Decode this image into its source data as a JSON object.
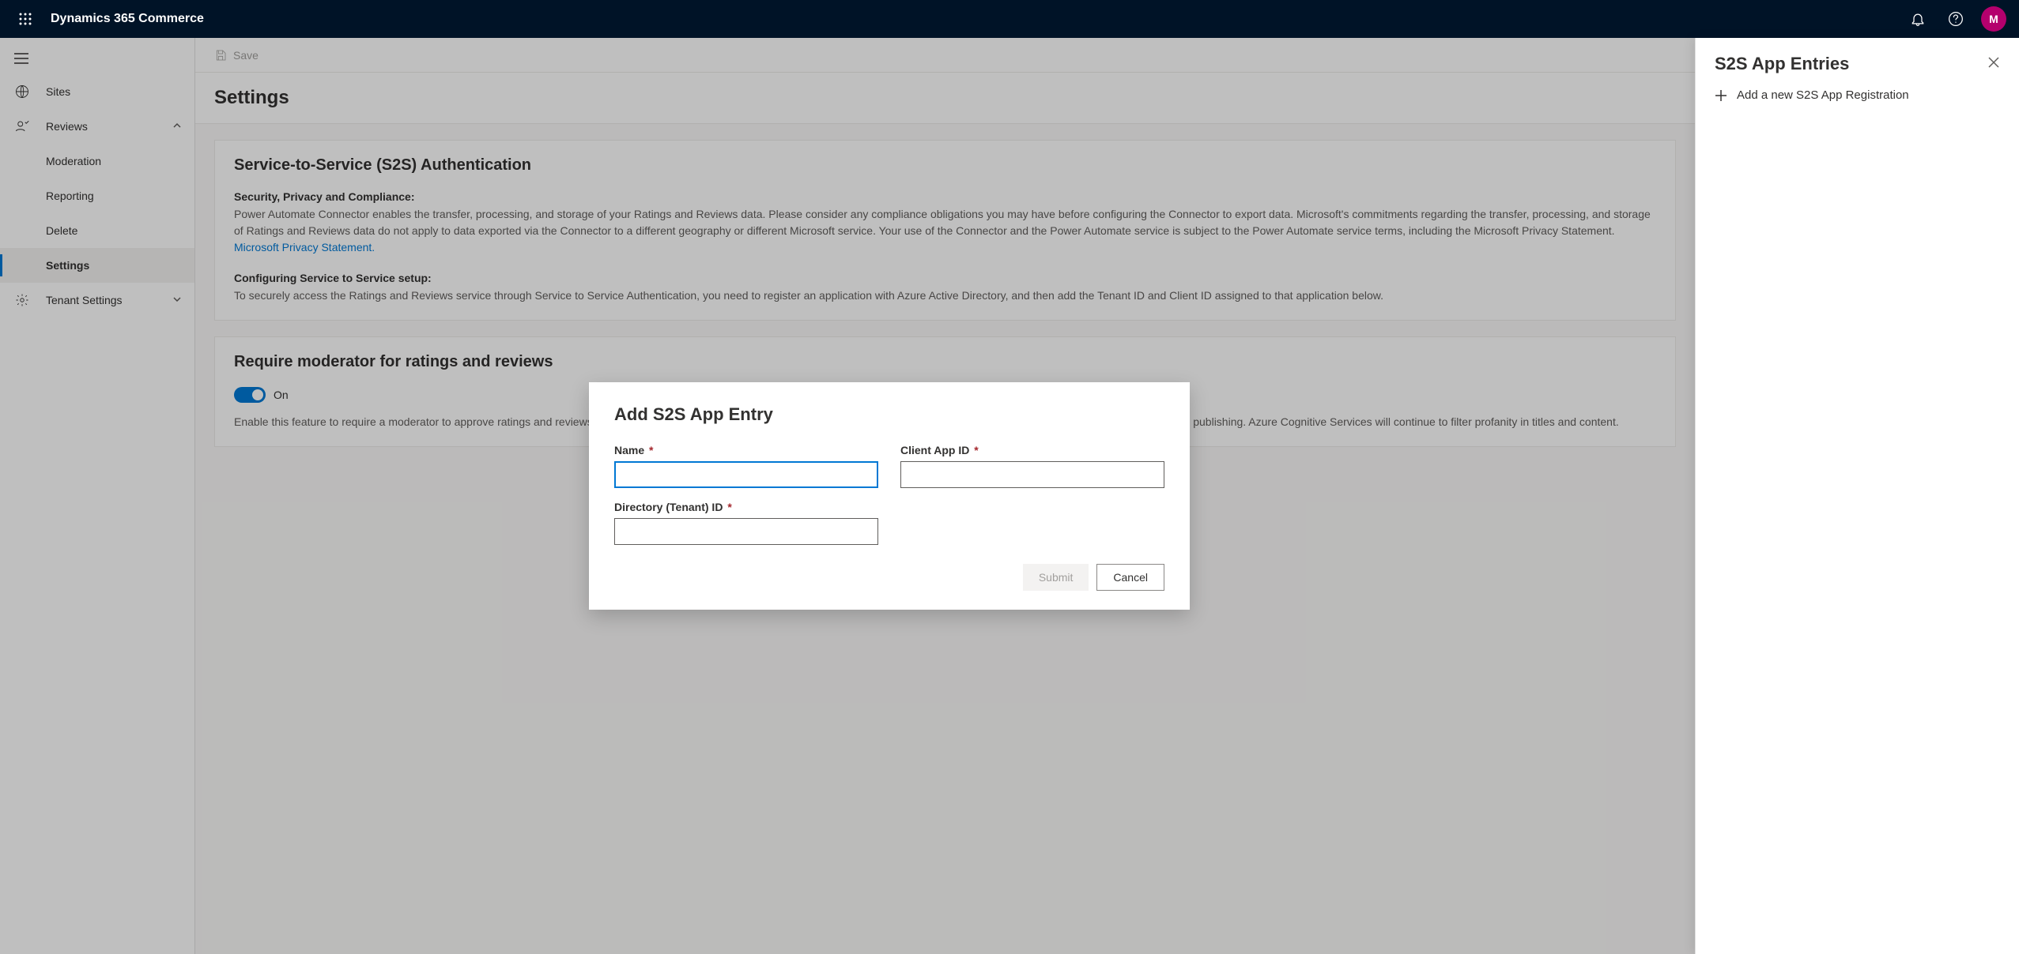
{
  "topbar": {
    "app_title": "Dynamics 365 Commerce",
    "avatar_initial": "M"
  },
  "nav": {
    "sites": "Sites",
    "reviews": "Reviews",
    "moderation": "Moderation",
    "reporting": "Reporting",
    "delete": "Delete",
    "settings": "Settings",
    "tenant_settings": "Tenant Settings"
  },
  "commandbar": {
    "save": "Save"
  },
  "page": {
    "title": "Settings"
  },
  "card_s2s": {
    "title": "Service-to-Service (S2S) Authentication",
    "sec_head": "Security, Privacy and Compliance:",
    "sec_body_1": "Power Automate Connector enables the transfer, processing, and storage of your Ratings and Reviews data. Please consider any compliance obligations you may have before configuring the Connector to export data. Microsoft's commitments regarding the transfer, processing, and storage of Ratings and Reviews data do not apply to data exported via the Connector to a different geography or different Microsoft service. Your use of the Connector and the Power Automate service is subject to the Power Automate service terms, including the Microsoft Privacy Statement. ",
    "sec_link": "Microsoft Privacy Statement.",
    "conf_head": "Configuring Service to Service setup:",
    "conf_body": "To securely access the Ratings and Reviews service through Service to Service Authentication, you need to register an application with Azure Active Directory, and then add the Tenant ID and Client ID assigned to that application below."
  },
  "card_mod": {
    "title": "Require moderator for ratings and reviews",
    "toggle_state": "On",
    "body": "Enable this feature to require a moderator to approve ratings and reviews before publishing. Enabling this feature will also remove machine learning based review filtering for explicit content before publishing. Azure Cognitive Services will continue to filter profanity in titles and content."
  },
  "panel": {
    "title": "S2S App Entries",
    "add_action": "Add a new S2S App Registration"
  },
  "dialog": {
    "title": "Add S2S App Entry",
    "name_label": "Name",
    "client_label": "Client App ID",
    "tenant_label": "Directory (Tenant) ID",
    "submit": "Submit",
    "cancel": "Cancel"
  }
}
